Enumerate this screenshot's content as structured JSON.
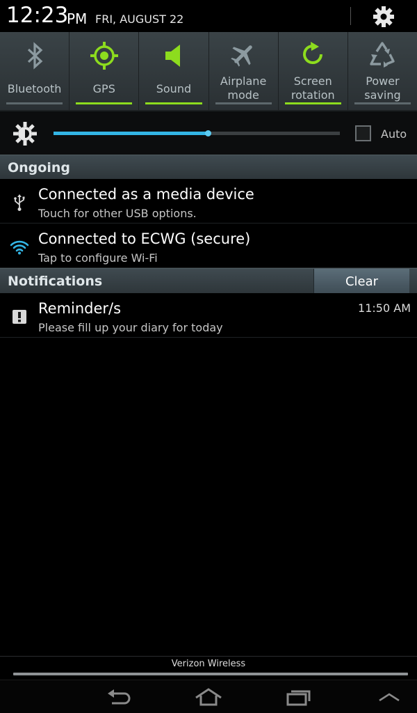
{
  "status": {
    "time": "12:23",
    "ampm": "PM",
    "date": "FRI, AUGUST 22"
  },
  "toggles": [
    {
      "label_line1": "Bluetooth",
      "label_line2": "",
      "on": false,
      "icon": "bluetooth-icon"
    },
    {
      "label_line1": "GPS",
      "label_line2": "",
      "on": true,
      "icon": "gps-icon"
    },
    {
      "label_line1": "Sound",
      "label_line2": "",
      "on": true,
      "icon": "sound-icon"
    },
    {
      "label_line1": "Airplane",
      "label_line2": "mode",
      "on": false,
      "icon": "airplane-icon"
    },
    {
      "label_line1": "Screen",
      "label_line2": "rotation",
      "on": true,
      "icon": "rotation-icon"
    },
    {
      "label_line1": "Power",
      "label_line2": "saving",
      "on": false,
      "icon": "recycle-icon"
    }
  ],
  "brightness": {
    "level": 0.54,
    "auto_label": "Auto",
    "auto_checked": false
  },
  "ongoing": {
    "title": "Ongoing",
    "items": [
      {
        "title": "Connected as a media device",
        "subtitle": "Touch for other USB options.",
        "icon": "usb-icon"
      },
      {
        "title": "Connected to ECWG (secure)",
        "subtitle": "Tap to configure Wi-Fi",
        "icon": "wifi-icon"
      }
    ]
  },
  "notifications": {
    "title": "Notifications",
    "clear_label": "Clear",
    "items": [
      {
        "title": "Reminder/s",
        "subtitle": "Please fill up your diary for today",
        "time": "11:50 AM",
        "icon": "alert-icon"
      }
    ]
  },
  "carrier": "Verizon Wireless",
  "colors": {
    "accent_green": "#8ddc1e",
    "accent_blue": "#33b5e5"
  }
}
